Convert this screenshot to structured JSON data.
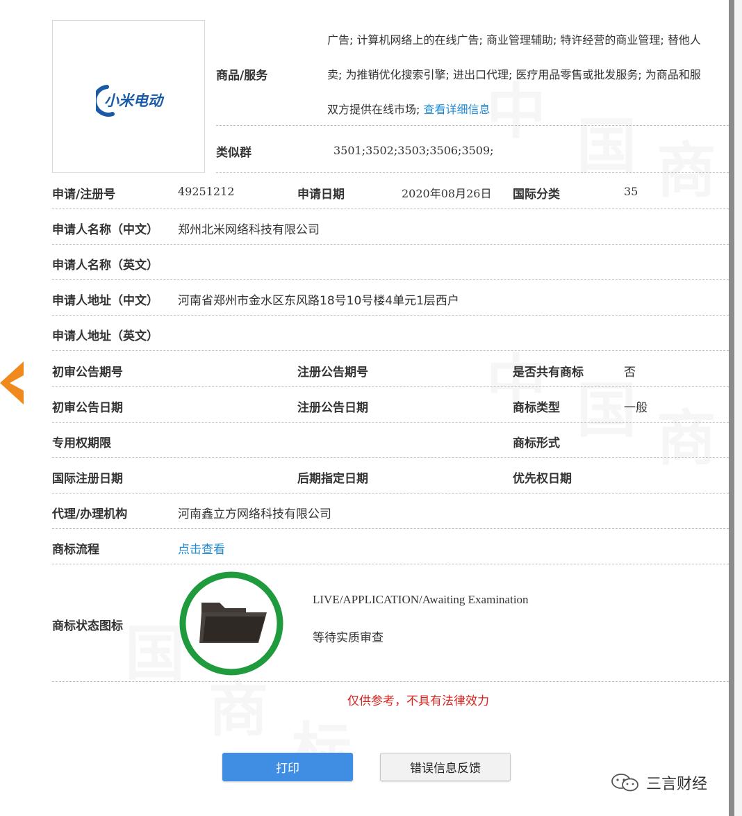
{
  "goods_services": {
    "label": "商品/服务",
    "lines": [
      "广告; 计算机网络上的在线广告; 商业管理辅助; 特许经营的商业管理; 替他人",
      "卖; 为推销优化搜索引擎; 进出口代理; 医疗用品零售或批发服务; 为商品和服",
      "双方提供在线市场; "
    ],
    "link": "查看详细信息"
  },
  "similar_group": {
    "label": "类似群",
    "value": "3501;3502;3503;3506;3509;"
  },
  "registration": {
    "no_label": "申请/注册号",
    "no_value": "49251212",
    "date_label": "申请日期",
    "date_value": "2020年08月26日",
    "class_label": "国际分类",
    "class_value": "35"
  },
  "applicant": {
    "name_cn_label": "申请人名称（中文）",
    "name_cn_value": "郑州北米网络科技有限公司",
    "name_en_label": "申请人名称（英文）",
    "addr_cn_label": "申请人地址（中文）",
    "addr_cn_value": "河南省郑州市金水区东风路18号10号楼4单元1层西户",
    "addr_en_label": "申请人地址（英文）"
  },
  "announcement": {
    "prelim_no_label": "初审公告期号",
    "reg_no_label": "注册公告期号",
    "shared_label": "是否共有商标",
    "shared_value": "否",
    "prelim_date_label": "初审公告日期",
    "reg_date_label": "注册公告日期",
    "type_label": "商标类型",
    "type_value": "一般"
  },
  "rights": {
    "exclusive_label": "专用权期限",
    "form_label": "商标形式",
    "intl_reg_label": "国际注册日期",
    "later_label": "后期指定日期",
    "priority_label": "优先权日期"
  },
  "agent": {
    "label": "代理/办理机构",
    "value": "河南鑫立方网络科技有限公司"
  },
  "process": {
    "label": "商标流程",
    "link": "点击查看"
  },
  "status": {
    "label": "商标状态图标",
    "en": "LIVE/APPLICATION/Awaiting Examination",
    "cn": "等待实质审查",
    "ring_color": "#1f9a3c"
  },
  "logo": {
    "text": "小米电动",
    "color": "#1a5aa6"
  },
  "disclaimer": "仅供参考，不具有法律效力",
  "buttons": {
    "print": "打印",
    "feedback": "错误信息反馈"
  },
  "footer": {
    "brand": "三言财经"
  },
  "watermark": [
    "中",
    "国",
    "商",
    "标"
  ],
  "colors": {
    "link": "#1f8ad2",
    "nav_arrow": "#f08a1c",
    "print_button": "#3f8ee3",
    "disclaimer": "#d8231f"
  }
}
